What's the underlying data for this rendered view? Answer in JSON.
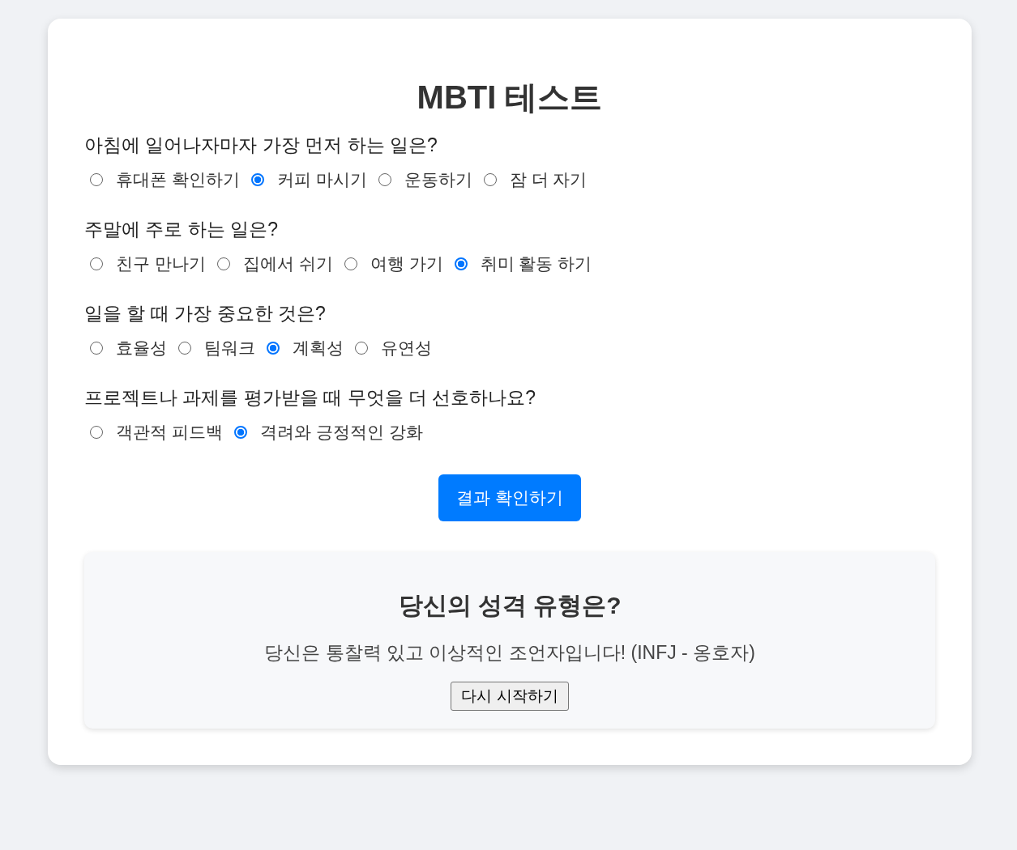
{
  "title": "MBTI 테스트",
  "questions": [
    {
      "text": "아침에 일어나자마자 가장 먼저 하는 일은?",
      "options": [
        {
          "label": "휴대폰 확인하기",
          "selected": false
        },
        {
          "label": "커피 마시기",
          "selected": true
        },
        {
          "label": "운동하기",
          "selected": false
        },
        {
          "label": "잠 더 자기",
          "selected": false
        }
      ]
    },
    {
      "text": "주말에 주로 하는 일은?",
      "options": [
        {
          "label": "친구 만나기",
          "selected": false
        },
        {
          "label": "집에서 쉬기",
          "selected": false
        },
        {
          "label": "여행 가기",
          "selected": false
        },
        {
          "label": "취미 활동 하기",
          "selected": true
        }
      ]
    },
    {
      "text": "일을 할 때 가장 중요한 것은?",
      "options": [
        {
          "label": "효율성",
          "selected": false
        },
        {
          "label": "팀워크",
          "selected": false
        },
        {
          "label": "계획성",
          "selected": true
        },
        {
          "label": "유연성",
          "selected": false
        }
      ]
    },
    {
      "text": "프로젝트나 과제를 평가받을 때 무엇을 더 선호하나요?",
      "options": [
        {
          "label": "객관적 피드백",
          "selected": false
        },
        {
          "label": "격려와 긍정적인 강화",
          "selected": true
        }
      ]
    }
  ],
  "submit_button": "결과 확인하기",
  "result": {
    "heading": "당신의 성격 유형은?",
    "text": "당신은 통찰력 있고 이상적인 조언자입니다! (INFJ - 옹호자)",
    "restart_button": "다시 시작하기"
  }
}
